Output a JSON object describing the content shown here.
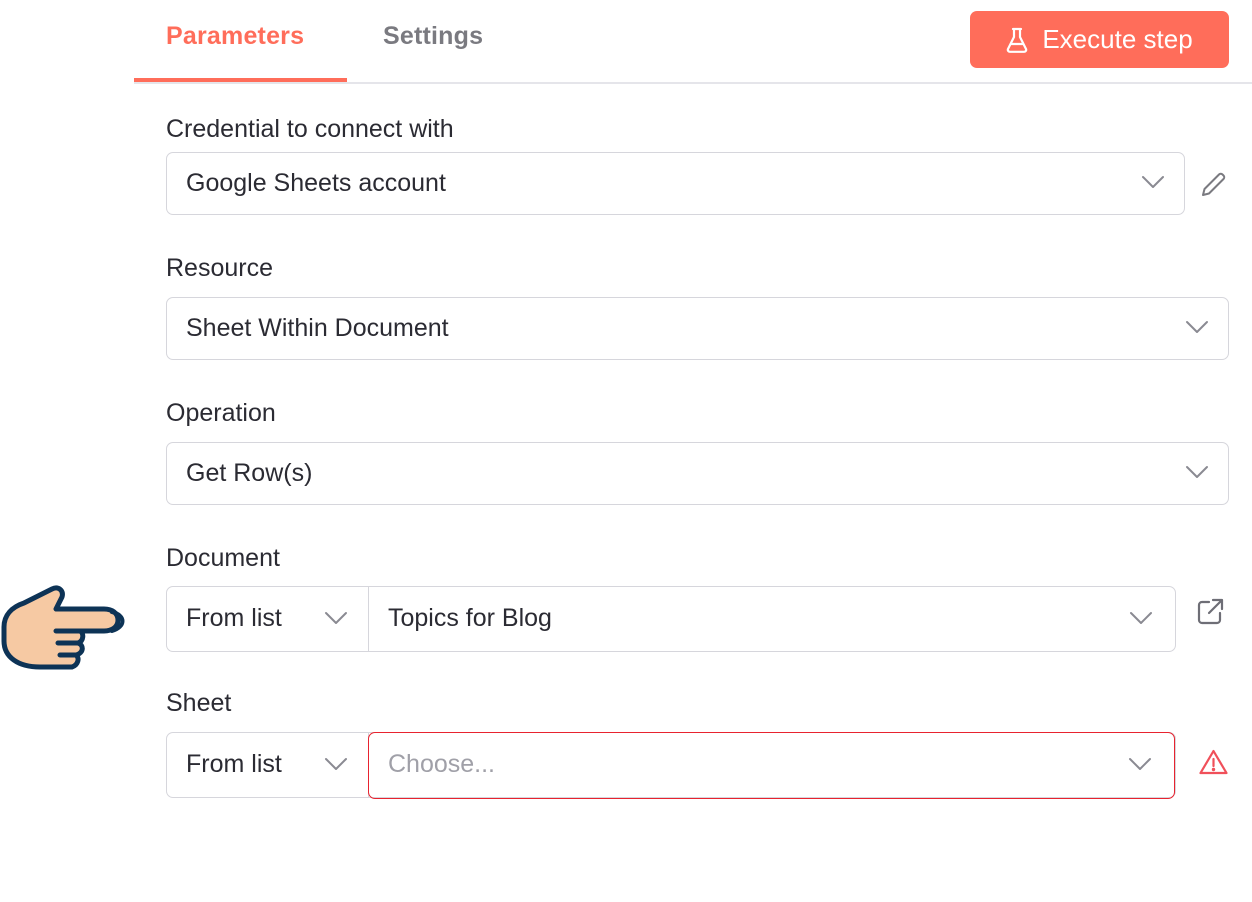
{
  "tabs": {
    "parameters": "Parameters",
    "settings": "Settings"
  },
  "execute_button": {
    "label": "Execute step",
    "icon": "flask-icon"
  },
  "colors": {
    "accent": "#ff6d5a",
    "error": "#e8232f",
    "border": "#d6d6dc"
  },
  "fields": {
    "credential": {
      "label": "Credential to connect with",
      "value": "Google Sheets account"
    },
    "resource": {
      "label": "Resource",
      "value": "Sheet Within Document"
    },
    "operation": {
      "label": "Operation",
      "value": "Get Row(s)"
    },
    "document": {
      "label": "Document",
      "mode": "From list",
      "value": "Topics for Blog"
    },
    "sheet": {
      "label": "Sheet",
      "mode": "From list",
      "placeholder": "Choose..."
    }
  }
}
